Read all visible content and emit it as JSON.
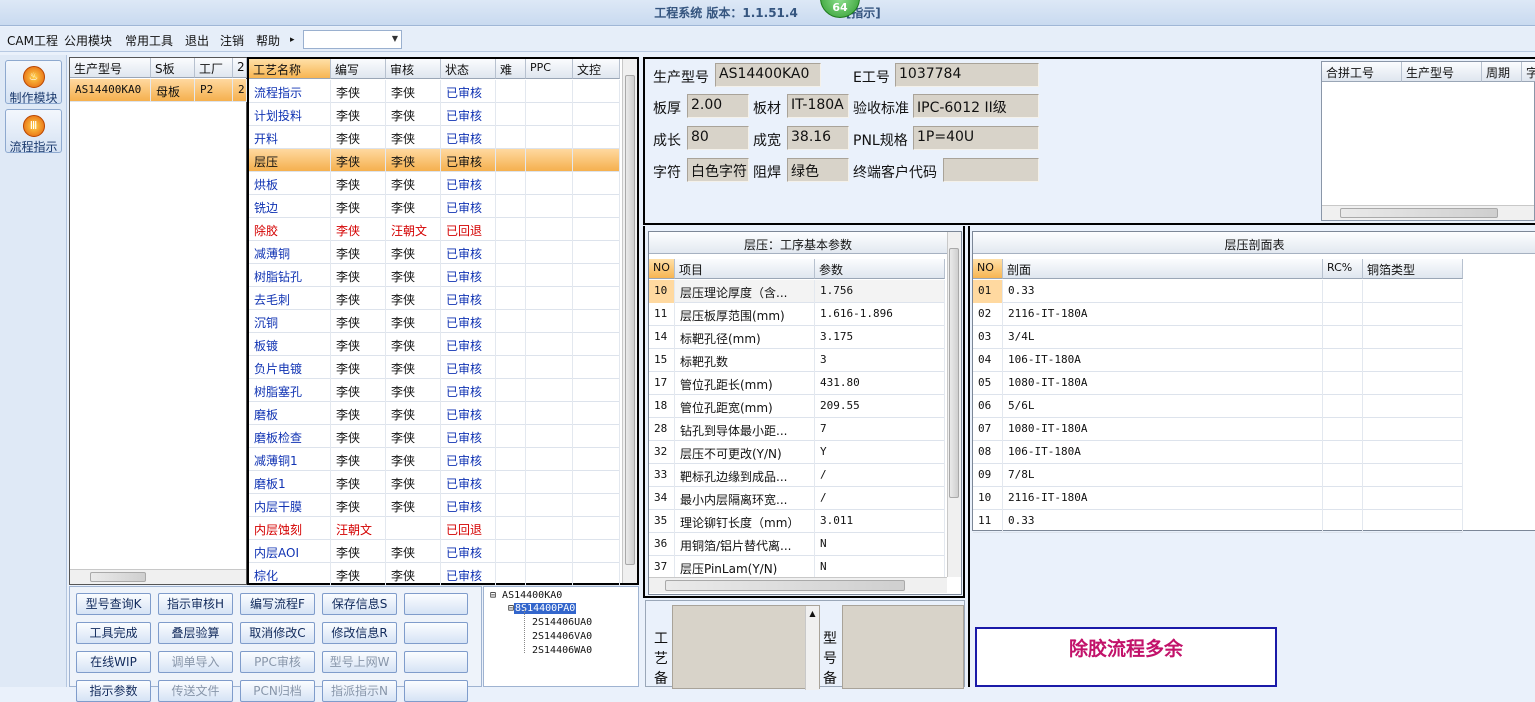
{
  "title": {
    "text": "工程系统   版本：1.1.51.4",
    "badge": "64",
    "suffix": "[指示]"
  },
  "menu": {
    "items": [
      "CAM工程",
      "公用模块",
      "常用工具",
      "退出",
      "注销",
      "帮助"
    ],
    "help_arrow": "▸",
    "combo_value": ""
  },
  "modules": [
    {
      "label": "制作模块",
      "icon": "flame-icon"
    },
    {
      "label": "流程指示",
      "icon": "flow-icon"
    }
  ],
  "model_grid": {
    "headers": [
      "生产型号",
      "S板",
      "工厂",
      "2"
    ],
    "rows": [
      [
        "AS14400KA0",
        "母板",
        "P2",
        "2"
      ]
    ]
  },
  "process_grid": {
    "headers": [
      "工艺名称",
      "编写",
      "审核",
      "状态",
      "难",
      "PPC",
      "文控"
    ],
    "rows": [
      {
        "name": "流程指示",
        "writer": "李侠",
        "reviewer": "李侠",
        "status": "已审核",
        "style": "blue"
      },
      {
        "name": "计划投料",
        "writer": "李侠",
        "reviewer": "李侠",
        "status": "已审核",
        "style": "blue"
      },
      {
        "name": "开料",
        "writer": "李侠",
        "reviewer": "李侠",
        "status": "已审核",
        "style": "blue"
      },
      {
        "name": "层压",
        "writer": "李侠",
        "reviewer": "李侠",
        "status": "已审核",
        "style": "sel"
      },
      {
        "name": "烘板",
        "writer": "李侠",
        "reviewer": "李侠",
        "status": "已审核",
        "style": "blue"
      },
      {
        "name": "铣边",
        "writer": "李侠",
        "reviewer": "李侠",
        "status": "已审核",
        "style": "blue"
      },
      {
        "name": "除胶",
        "writer": "李侠",
        "reviewer": "汪朝文",
        "status": "已回退",
        "style": "red"
      },
      {
        "name": "减薄铜",
        "writer": "李侠",
        "reviewer": "李侠",
        "status": "已审核",
        "style": "blue"
      },
      {
        "name": "树脂钻孔",
        "writer": "李侠",
        "reviewer": "李侠",
        "status": "已审核",
        "style": "blue"
      },
      {
        "name": "去毛刺",
        "writer": "李侠",
        "reviewer": "李侠",
        "status": "已审核",
        "style": "blue"
      },
      {
        "name": "沉铜",
        "writer": "李侠",
        "reviewer": "李侠",
        "status": "已审核",
        "style": "blue"
      },
      {
        "name": "板镀",
        "writer": "李侠",
        "reviewer": "李侠",
        "status": "已审核",
        "style": "blue"
      },
      {
        "name": "负片电镀",
        "writer": "李侠",
        "reviewer": "李侠",
        "status": "已审核",
        "style": "blue"
      },
      {
        "name": "树脂塞孔",
        "writer": "李侠",
        "reviewer": "李侠",
        "status": "已审核",
        "style": "blue"
      },
      {
        "name": "磨板",
        "writer": "李侠",
        "reviewer": "李侠",
        "status": "已审核",
        "style": "blue"
      },
      {
        "name": "磨板检查",
        "writer": "李侠",
        "reviewer": "李侠",
        "status": "已审核",
        "style": "blue"
      },
      {
        "name": "减薄铜1",
        "writer": "李侠",
        "reviewer": "李侠",
        "status": "已审核",
        "style": "blue"
      },
      {
        "name": "磨板1",
        "writer": "李侠",
        "reviewer": "李侠",
        "status": "已审核",
        "style": "blue"
      },
      {
        "name": "内层干膜",
        "writer": "李侠",
        "reviewer": "李侠",
        "status": "已审核",
        "style": "blue"
      },
      {
        "name": "内层蚀刻",
        "writer": "汪朝文",
        "reviewer": "",
        "status": "已回退",
        "style": "red"
      },
      {
        "name": "内层AOI",
        "writer": "李侠",
        "reviewer": "李侠",
        "status": "已审核",
        "style": "blue"
      },
      {
        "name": "棕化",
        "writer": "李侠",
        "reviewer": "李侠",
        "status": "已审核",
        "style": "blue"
      }
    ]
  },
  "buttons": [
    [
      "型号查询K",
      "指示审核H",
      "编写流程F",
      "保存信息S",
      ""
    ],
    [
      "工具完成",
      "叠层验算",
      "取消修改C",
      "修改信息R",
      ""
    ],
    [
      "在线WIP",
      "调单导入",
      "PPC审核",
      "型号上网W",
      ""
    ],
    [
      "指示参数",
      "传送文件",
      "PCN归档",
      "指派指示N",
      ""
    ]
  ],
  "tree": {
    "root": "AS14400KA0",
    "child": "8S14400PA0",
    "leaves": [
      "2S14406UA0",
      "2S14406VA0",
      "2S14406WA0"
    ]
  },
  "info": {
    "labels": {
      "model": "生产型号",
      "eno": "E工号",
      "thickness": "板厚",
      "material": "板材",
      "standard": "验收标准",
      "length": "成长",
      "width": "成宽",
      "pnl": "PNL规格",
      "char": "字符",
      "mask": "阻焊",
      "customer": "终端客户代码"
    },
    "values": {
      "model": "AS14400KA0",
      "eno": "1037784",
      "thickness": "2.00",
      "material": "IT-180A",
      "standard": "IPC-6012 II级",
      "length": "80",
      "width": "38.16",
      "pnl": "1P=40U",
      "char": "白色字符",
      "mask": "绿色",
      "customer": ""
    }
  },
  "merge_grid": {
    "headers": [
      "合拼工号",
      "生产型号",
      "周期",
      "字"
    ]
  },
  "params": {
    "title": "层压：工序基本参数",
    "headers": [
      "NO",
      "项目",
      "参数"
    ],
    "rows": [
      [
        "10",
        "层压理论厚度（含...",
        "1.756"
      ],
      [
        "11",
        "层压板厚范围(mm)",
        "1.616-1.896"
      ],
      [
        "14",
        "标靶孔径(mm)",
        "3.175"
      ],
      [
        "15",
        "标靶孔数",
        "3"
      ],
      [
        "17",
        "管位孔距长(mm)",
        "431.80"
      ],
      [
        "18",
        "管位孔距宽(mm)",
        "209.55"
      ],
      [
        "28",
        "钻孔到导体最小距...",
        "7"
      ],
      [
        "32",
        "层压不可更改(Y/N)",
        "Y"
      ],
      [
        "33",
        "靶标孔边缘到成品...",
        "/"
      ],
      [
        "34",
        "最小内层隔离环宽...",
        "/"
      ],
      [
        "35",
        "理论铆钉长度（mm）",
        "3.011"
      ],
      [
        "36",
        "用铜箔/铝片替代离...",
        "N"
      ],
      [
        "37",
        "层压PinLam(Y/N)",
        "N"
      ]
    ]
  },
  "stackup": {
    "title": "层压剖面表",
    "headers": [
      "NO",
      "剖面",
      "RC%",
      "铜箔类型"
    ],
    "rows": [
      [
        "01",
        "0.33"
      ],
      [
        "02",
        "2116-IT-180A"
      ],
      [
        "03",
        "3/4L"
      ],
      [
        "04",
        "106-IT-180A"
      ],
      [
        "05",
        "1080-IT-180A"
      ],
      [
        "06",
        "5/6L"
      ],
      [
        "07",
        "1080-IT-180A"
      ],
      [
        "08",
        "106-IT-180A"
      ],
      [
        "09",
        "7/8L"
      ],
      [
        "10",
        "2116-IT-180A"
      ],
      [
        "11",
        "0.33"
      ]
    ]
  },
  "notes": {
    "process_label": "工艺备",
    "model_label": "型号备"
  },
  "warning": "除胶流程多余"
}
